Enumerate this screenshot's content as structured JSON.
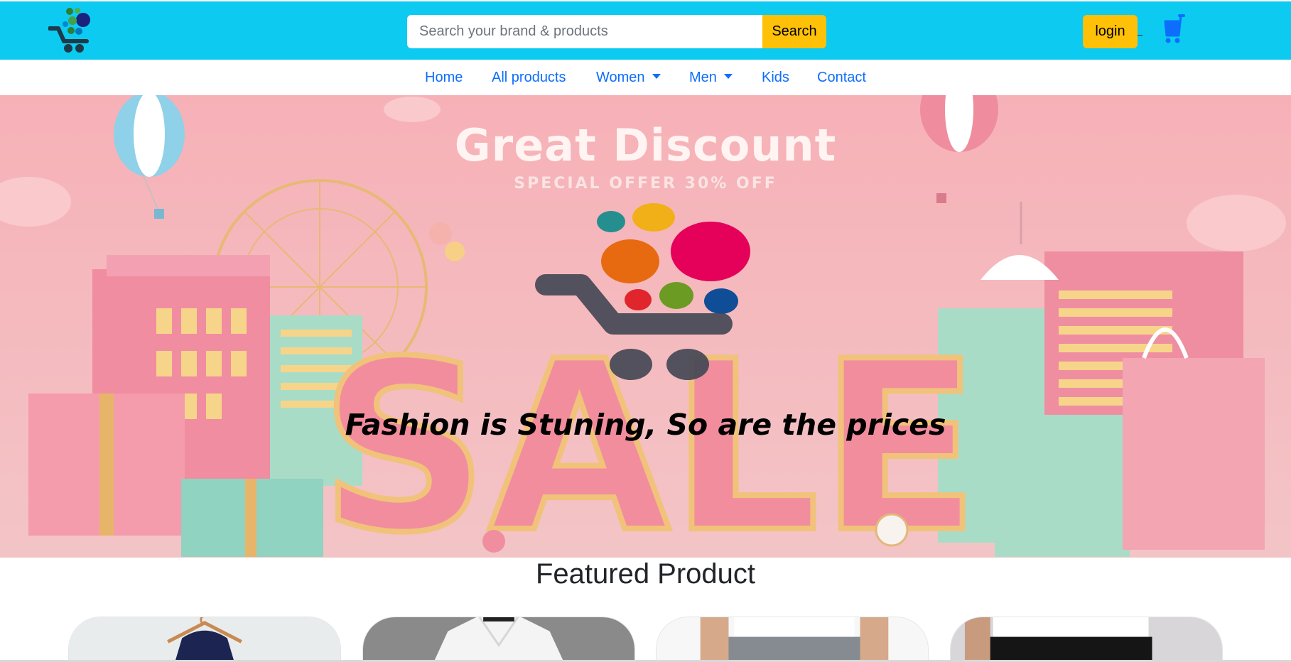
{
  "header": {
    "logo_icon": "shopping-cart-logo-icon",
    "search_placeholder": "Search your brand & products",
    "search_label": "Search",
    "login_label": "login",
    "cart_icon": "cart-icon",
    "background": "#0dcaf0",
    "button_color": "#ffc107"
  },
  "nav": {
    "items": [
      {
        "label": "Home"
      },
      {
        "label": "All products"
      },
      {
        "label": "Women",
        "dropdown": true
      },
      {
        "label": "Men",
        "dropdown": true
      },
      {
        "label": "Kids"
      },
      {
        "label": "Contact"
      }
    ],
    "link_color": "#0d6efd"
  },
  "hero": {
    "title": "Great Discount",
    "subtitle": "SPECIAL OFFER 30% OFF",
    "sale_text": "SALE",
    "tagline": "Fashion is Stuning, So are the prices"
  },
  "featured": {
    "heading": "Featured Product",
    "products": [
      {
        "image": "navy-tshirt-on-hanger"
      },
      {
        "image": "white-shirt-on-grey"
      },
      {
        "image": "grey-jeans-model"
      },
      {
        "image": "black-jeans-model"
      }
    ]
  }
}
